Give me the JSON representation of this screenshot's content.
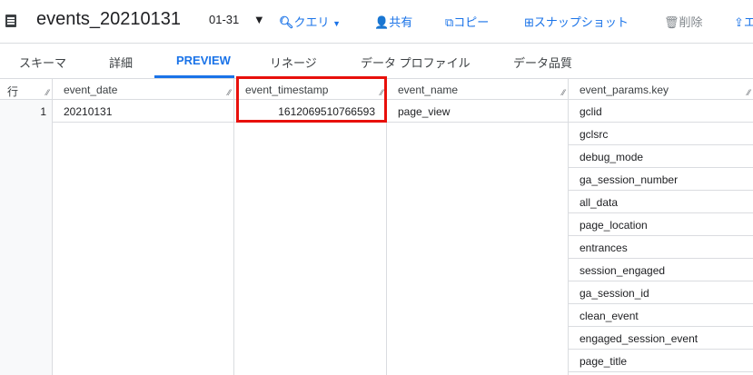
{
  "toolbar": {
    "title": "events_20210131",
    "date": "01-31",
    "query": "クエリ",
    "share": "共有",
    "copy": "コピー",
    "snapshot": "スナップショット",
    "delete": "削除",
    "export": "エ"
  },
  "tabs": [
    "スキーマ",
    "詳細",
    "PREVIEW",
    "リネージ",
    "データ プロファイル",
    "データ品質"
  ],
  "table": {
    "headers": {
      "row": "行",
      "event_date": "event_date",
      "event_timestamp": "event_timestamp",
      "event_name": "event_name",
      "event_params_key": "event_params.key"
    },
    "row": {
      "num": "1",
      "event_date": "20210131",
      "event_timestamp": "1612069510766593",
      "event_name": "page_view"
    },
    "param_keys": [
      "gclid",
      "gclsrc",
      "debug_mode",
      "ga_session_number",
      "all_data",
      "page_location",
      "entrances",
      "session_engaged",
      "ga_session_id",
      "clean_event",
      "engaged_session_event",
      "page_title"
    ]
  }
}
